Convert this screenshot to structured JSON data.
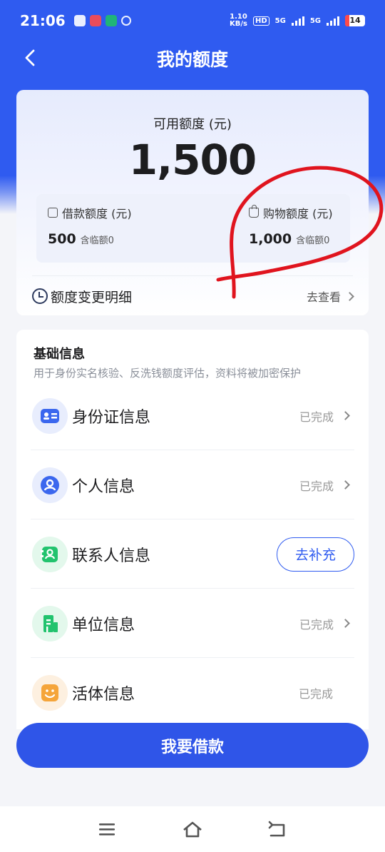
{
  "status_bar": {
    "time": "21:06",
    "net_speed_value": "1.10",
    "net_speed_unit": "KB/s",
    "hd": "HD",
    "net1": "5G",
    "net2": "5G",
    "battery": "14"
  },
  "nav": {
    "title": "我的额度",
    "back_icon": "chevron-left-icon"
  },
  "quota": {
    "available_label": "可用额度 (元)",
    "available_amount": "1,500",
    "loan": {
      "label": "借款额度 (元)",
      "amount": "500",
      "temp": "含临额0",
      "icon": "yen-icon"
    },
    "shopping": {
      "label": "购物额度 (元)",
      "amount": "1,000",
      "temp": "含临额0",
      "icon": "bag-icon"
    },
    "history": {
      "label": "额度变更明细",
      "link": "去查看",
      "icon": "history-clock-icon"
    }
  },
  "basic_info": {
    "title": "基础信息",
    "description": "用于身份实名核验、反洗钱额度评估，资料将被加密保护",
    "items": [
      {
        "label": "身份证信息",
        "status": "已完成",
        "icon": "id-card-icon",
        "color": "#3b67ee",
        "bg": "#e8edfd"
      },
      {
        "label": "个人信息",
        "status": "已完成",
        "icon": "person-icon",
        "color": "#3b67ee",
        "bg": "#e8edfd"
      },
      {
        "label": "联系人信息",
        "action": "去补充",
        "icon": "contacts-icon",
        "color": "#22c36e",
        "bg": "#e3f8ec"
      },
      {
        "label": "单位信息",
        "status": "已完成",
        "icon": "building-icon",
        "color": "#22c36e",
        "bg": "#e3f8ec"
      },
      {
        "label": "活体信息",
        "status": "已完成",
        "icon": "face-icon",
        "color": "#f5a53a",
        "bg": "#fdf0e0"
      }
    ]
  },
  "borrow_button": "我要借款",
  "system_nav": {
    "menu_icon": "menu-icon",
    "home_icon": "home-icon",
    "back_icon": "back-arrow-icon"
  },
  "colors": {
    "brand": "#2f5bf0",
    "annotation": "#e0141e"
  }
}
